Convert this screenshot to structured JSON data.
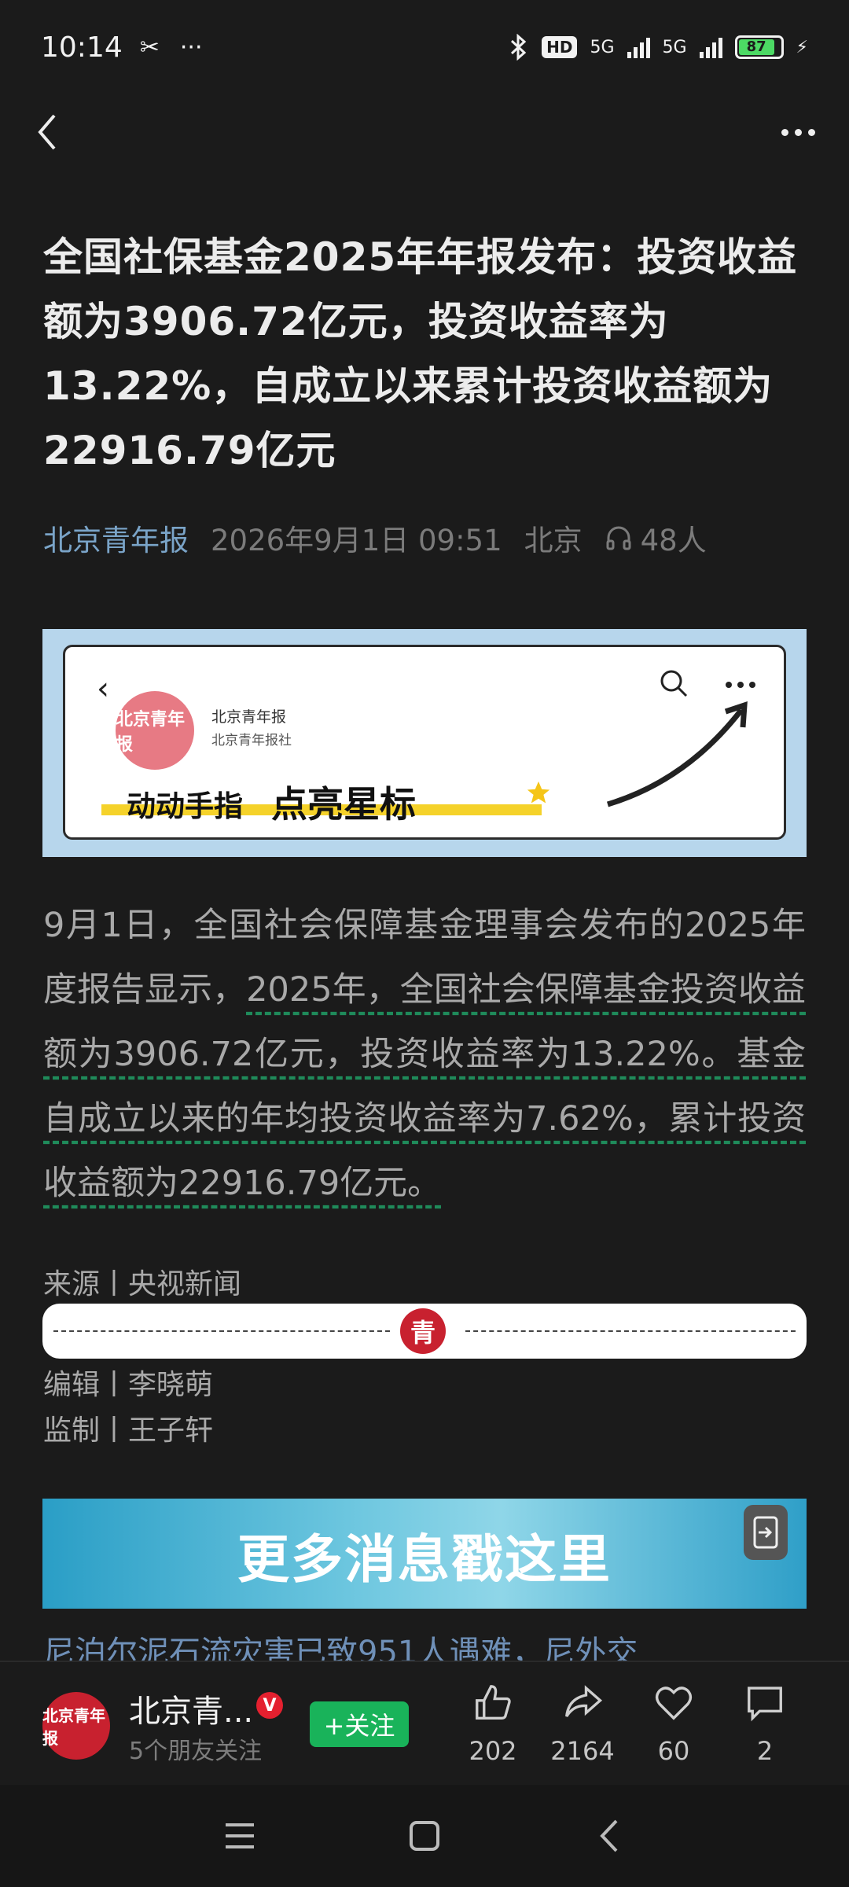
{
  "status_bar": {
    "time": "10:14",
    "left_icons": [
      "scissors-icon",
      "more-dots"
    ],
    "hd": "HD",
    "net1": "5G",
    "net2": "5G",
    "battery": "87"
  },
  "article": {
    "title": "全国社保基金2025年年报发布：投资收益额为3906.72亿元，投资收益率为13.22%，自成立以来累计投资收益额为22916.79亿元",
    "source": "北京青年报",
    "datetime": "2026年9月1日 09:51",
    "location": "北京",
    "listeners": "48人",
    "body_part1": "9月1日，全国社会保障基金理事会发布的2025年度报告显示，",
    "body_part2": "2025年，全国社会保障基金投资收益额为3906.72亿元，投资收益率为13.22%。基金自成立以来的年均投资收益率为7.62%，累计投资收益额为22916.79亿元。",
    "source_line": "来源丨央视新闻",
    "editor_line": "编辑丨李晓萌",
    "supervisor_line": "监制丨王子轩",
    "next_article": "尼泊尔泥石流灾害已致951人遇难，尼外交"
  },
  "banner1": {
    "account_name": "北京青年报",
    "account_sub": "北京青年报社",
    "text_small": "动动手指",
    "text_big": "点亮星标",
    "logo_text": "北京青年报"
  },
  "divider": {
    "logo_char": "青"
  },
  "banner2": {
    "text": "更多消息戳这里"
  },
  "action_bar": {
    "account_name": "北京青...",
    "verified": "V",
    "friends": "5个朋友关注",
    "follow": "+关注",
    "likes": "202",
    "shares": "2164",
    "favorites": "60",
    "comments": "2",
    "avatar_text": "北京青年报"
  }
}
